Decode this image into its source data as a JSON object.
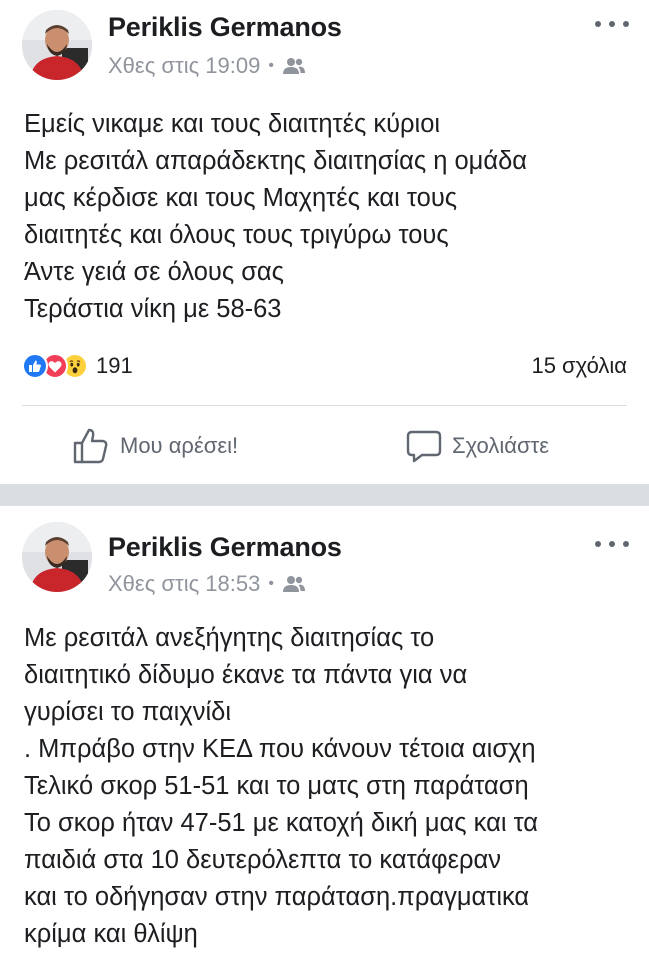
{
  "posts": [
    {
      "author": "Periklis Germanos",
      "timestamp": "Χθες στις 19:09",
      "separator": "•",
      "audience_icon": "friends-icon",
      "lines": [
        "Εμείς νικαμε και τους διαιτητές κύριοι",
        "Με ρεσιτάλ απαράδεκτης διαιτησίας η ομάδα",
        "μας κέρδισε και τους Μαχητές και τους",
        "διαιτητές και όλους τους τριγύρω τους",
        "Άντε γειά σε όλους σας",
        "Τεράστια νίκη με 58-63"
      ],
      "reactions": [
        "like",
        "love",
        "wow"
      ],
      "reaction_count": "191",
      "comments": "15 σχόλια",
      "actions": {
        "like": "Μου αρέσει!",
        "comment": "Σχολιάστε"
      }
    },
    {
      "author": "Periklis Germanos",
      "timestamp": "Χθες στις 18:53",
      "separator": "•",
      "audience_icon": "friends-icon",
      "lines": [
        "Με ρεσιτάλ ανεξήγητης διαιτησίας το",
        "διαιτητικό δίδυμο έκανε τα πάντα για να",
        "γυρίσει το παιχνίδι",
        ". Μπράβο στην ΚΕΔ που κάνουν τέτοια αισχη",
        "Τελικό σκορ 51-51 και το ματς στη παράταση",
        "Το σκορ ήταν 47-51 με κατοχή δική μας και τα",
        "παιδιά στα 10 δευτερόλεπτα το κατάφεραν",
        "και το οδήγησαν στην παράταση.πραγματικα",
        "κρίμα και θλίψη"
      ]
    }
  ],
  "colors": {
    "like_blue": "#2078f4",
    "love_red": "#f33e58",
    "wow_yellow": "#fcd13c",
    "meta_gray": "#90949c",
    "action_gray": "#606770",
    "separator_gray": "#dadde1"
  }
}
